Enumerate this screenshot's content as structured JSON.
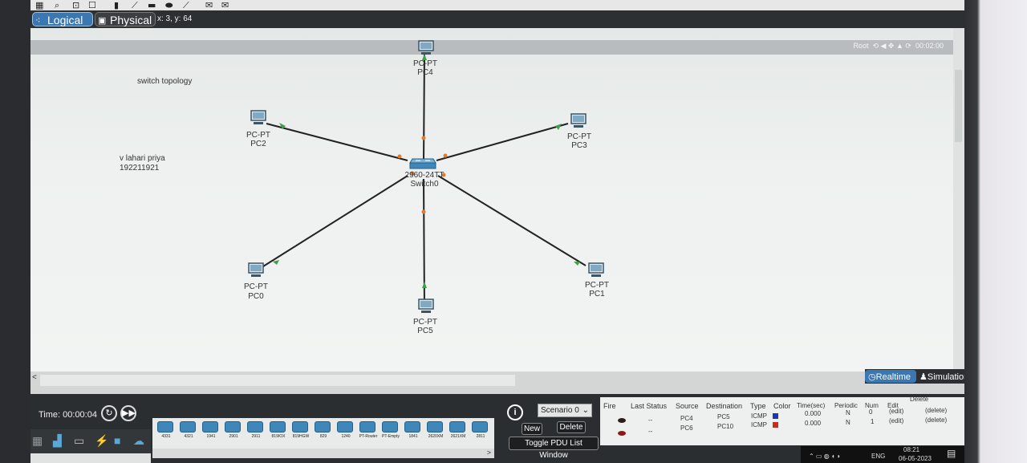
{
  "toolbar": {
    "icons": [
      "grid-icon",
      "search-icon",
      "zoom-icon",
      "note-icon",
      "line-icon",
      "rectangle-icon",
      "ellipse-icon",
      "pencil-icon",
      "envelope-icon",
      "open-envelope-icon"
    ]
  },
  "mode_bar": {
    "logical_label": "Logical",
    "physical_label": "Physical",
    "coords": "x: 3, y: 64",
    "accent": "#3b77b0"
  },
  "root_bar": {
    "label": "Root",
    "clock": "00:02:00"
  },
  "workspace": {
    "note_title": "switch topology",
    "note_name": "v lahari priya",
    "note_id": "192211921",
    "switch": {
      "model": "2960-24TT",
      "name": "Switch0"
    },
    "pcs": [
      {
        "model": "PC-PT",
        "name": "PC4"
      },
      {
        "model": "PC-PT",
        "name": "PC2"
      },
      {
        "model": "PC-PT",
        "name": "PC3"
      },
      {
        "model": "PC-PT",
        "name": "PC0"
      },
      {
        "model": "PC-PT",
        "name": "PC1"
      },
      {
        "model": "PC-PT",
        "name": "PC5"
      }
    ],
    "link_colors": {
      "line": "#222222",
      "up": "#3fa04a",
      "down": "#e07a2c"
    }
  },
  "mode_switch": {
    "realtime_label": "Realtime",
    "simulation_label": "Simulation"
  },
  "time_bar": {
    "time_label": "Time: 00:00:04"
  },
  "device_list": {
    "items": [
      "4331",
      "4321",
      "1941",
      "2901",
      "2911",
      "819IOX",
      "819HGW",
      "829",
      "1240",
      "PT-Router",
      "PT-Empty",
      "1841",
      "2620XM",
      "2621XM",
      "2811"
    ]
  },
  "scenario": {
    "selected": "Scenario 0",
    "new_label": "New",
    "delete_label": "Delete",
    "toggle_label": "Toggle PDU List Window"
  },
  "pdu_table": {
    "headers": [
      "Fire",
      "Last Status",
      "Source",
      "Destination",
      "Type",
      "Color",
      "Time(sec)",
      "Periodic",
      "Num",
      "Edit",
      "Delete"
    ],
    "rows": [
      {
        "status": "--",
        "source": "PC4",
        "destination": "PC5",
        "type": "ICMP",
        "color": "#2233bb",
        "time": "0.000",
        "periodic": "N",
        "num": "0",
        "edit": "(edit)",
        "delete": "(delete)"
      },
      {
        "status": "--",
        "source": "PC6",
        "destination": "PC10",
        "type": "ICMP",
        "color": "#cc2a1e",
        "time": "0.000",
        "periodic": "N",
        "num": "1",
        "edit": "(edit)",
        "delete": "(delete)"
      }
    ]
  },
  "taskbar": {
    "language": "ENG",
    "time": "08:21",
    "date": "06-05-2023"
  }
}
